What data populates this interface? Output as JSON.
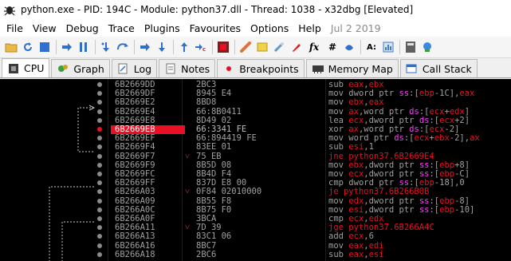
{
  "title": "python.exe - PID: 194C - Module: python37.dll - Thread: 1038 - x32dbg [Elevated]",
  "menu": [
    "File",
    "View",
    "Debug",
    "Trace",
    "Plugins",
    "Favourites",
    "Options",
    "Help",
    "Jul 2 2019"
  ],
  "toolbar": {
    "icons": [
      "open-icon",
      "restart-icon",
      "stop-icon",
      "run-icon",
      "pause-icon",
      "step-into-icon",
      "step-over-icon",
      "trace-into-icon",
      "trace-over-icon",
      "execute-till-return-icon",
      "run-to-user-code-icon",
      "breakpoints-icon",
      "patch-icon",
      "comments-icon",
      "labels-icon",
      "bookmarks-icon",
      "functions-icon",
      "variables-icon",
      "hash-icon",
      "font-icon",
      "script-icon",
      "calculator-icon",
      "about-icon"
    ],
    "fx_label": "fx",
    "hash_label": "#",
    "font_label": "A:"
  },
  "tabs": [
    {
      "label": "CPU",
      "icon": "cpu-icon",
      "active": true
    },
    {
      "label": "Graph",
      "icon": "graph-icon"
    },
    {
      "label": "Log",
      "icon": "log-icon"
    },
    {
      "label": "Notes",
      "icon": "notes-icon"
    },
    {
      "label": "Breakpoints",
      "icon": "breakpoint-dot-icon"
    },
    {
      "label": "Memory Map",
      "icon": "memory-map-icon"
    },
    {
      "label": "Call Stack",
      "icon": "call-stack-icon"
    }
  ],
  "colors": {
    "selection": "#e81123",
    "jump": "#e81123",
    "segment": "#ff3cff",
    "text": "#a0a0a0"
  },
  "disasm": [
    {
      "addr": "6B2669DD",
      "bytes": "2BC3",
      "mnem": "sub",
      "ops": "eax,ebx"
    },
    {
      "addr": "6B2669DF",
      "bytes": "8945 E4",
      "mnem": "mov",
      "ops": "dword ptr ss:[ebp-1C],eax"
    },
    {
      "addr": "6B2669E2",
      "bytes": "8BD8",
      "mnem": "mov",
      "ops": "ebx,eax"
    },
    {
      "addr": "6B2669E4",
      "bytes": "66:8B0411",
      "mnem": "mov",
      "ops": "ax,word ptr ds:[ecx+edx]"
    },
    {
      "addr": "6B2669E8",
      "bytes": "8D49 02",
      "mnem": "lea",
      "ops": "ecx,dword ptr ds:[ecx+2]"
    },
    {
      "addr": "6B2669EB",
      "bytes": "66:3341 FE",
      "mnem": "xor",
      "ops": "ax,word ptr ds:[ecx-2]",
      "selected": true,
      "bp": true
    },
    {
      "addr": "6B2669EF",
      "bytes": "66:894419 FE",
      "mnem": "mov",
      "ops": "word ptr ds:[ecx+ebx-2],ax"
    },
    {
      "addr": "6B2669F4",
      "bytes": "83EE 01",
      "mnem": "sub",
      "ops": "esi,1"
    },
    {
      "addr": "6B2669F7",
      "bytes": "75 EB",
      "mnem": "jne",
      "ops": "python37.6B2669E4",
      "jump": true
    },
    {
      "addr": "6B2669F9",
      "bytes": "8B5D 08",
      "mnem": "mov",
      "ops": "ebx,dword ptr ss:[ebp+8]"
    },
    {
      "addr": "6B2669FC",
      "bytes": "8B4D F4",
      "mnem": "mov",
      "ops": "ecx,dword ptr ss:[ebp-C]"
    },
    {
      "addr": "6B2669FF",
      "bytes": "837D E8 00",
      "mnem": "cmp",
      "ops": "dword ptr ss:[ebp-18],0"
    },
    {
      "addr": "6B266A03",
      "bytes": "0F84 02010000",
      "mnem": "je",
      "ops": "python37.6B266B0B",
      "jump": true
    },
    {
      "addr": "6B266A09",
      "bytes": "8B55 F8",
      "mnem": "mov",
      "ops": "edx,dword ptr ss:[ebp-8]"
    },
    {
      "addr": "6B266A0C",
      "bytes": "8B75 F0",
      "mnem": "mov",
      "ops": "esi,dword ptr ss:[ebp-10]"
    },
    {
      "addr": "6B266A0F",
      "bytes": "3BCA",
      "mnem": "cmp",
      "ops": "ecx,edx"
    },
    {
      "addr": "6B266A11",
      "bytes": "7D 39",
      "mnem": "jge",
      "ops": "python37.6B266A4C",
      "jump": true
    },
    {
      "addr": "6B266A13",
      "bytes": "83C1 06",
      "mnem": "add",
      "ops": "ecx,6"
    },
    {
      "addr": "6B266A16",
      "bytes": "8BC7",
      "mnem": "mov",
      "ops": "eax,edi"
    },
    {
      "addr": "6B266A18",
      "bytes": "2BC6",
      "mnem": "sub",
      "ops": "eax,esi"
    }
  ]
}
